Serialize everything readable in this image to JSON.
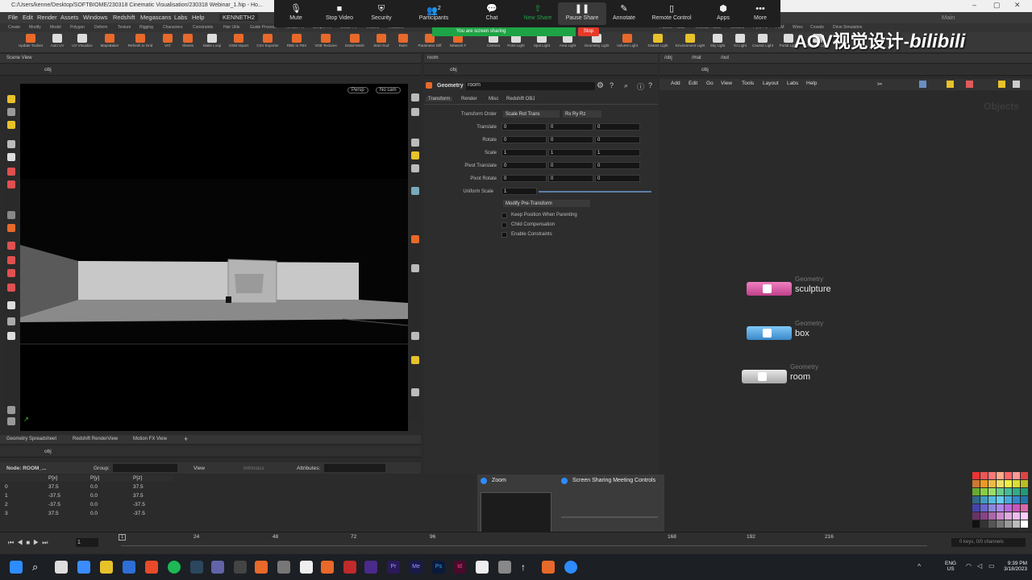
{
  "titlebar": {
    "path": "C:/Users/kenne/Desktop/SOFTBIOME/230318 Cinematic Visualisation/230318 Webinar_1.hip - Ho..."
  },
  "menubar": {
    "items": [
      "File",
      "Edit",
      "Render",
      "Assets",
      "Windows",
      "Redshift",
      "Megascans",
      "Labs",
      "Help"
    ],
    "desktop": "KENNETH2",
    "main": "Main"
  },
  "shelf_tabs": [
    "Create",
    "Modify",
    "Model",
    "Polygon",
    "Deform",
    "Texture",
    "Rigging",
    "Characters",
    "Constraints",
    "Hair Utils",
    "Guide Process",
    "Terrain FX",
    "Simple FX",
    "Cloud FX",
    "Volume",
    "Redshift",
    "Particle Fluids",
    "Viscous Fluids",
    "Oceans",
    "Pyro FX",
    "FEM",
    "Wires",
    "Crowds",
    "Drive Simulation"
  ],
  "shelf_tools": [
    "Update Toolset",
    "Auto UV",
    "UV Visualize",
    "MapsBaker",
    "Refresh to Grid",
    "VAT",
    "Sheets",
    "Make Loop",
    "OSM Import",
    "CSV Exporter",
    "RBD to FBX",
    "VDB Textures",
    "Detail Mesh",
    "Start GoZ",
    "Ruler",
    "Parameter Diff",
    "Network F",
    "Camera",
    "Point Light",
    "Spot Light",
    "Area Light",
    "Geometry Light",
    "Volume Light",
    "Distant Light",
    "Environment Light",
    "Sky Light",
    "GI Light",
    "Caustic Light",
    "Portal Light",
    "Ambient Light"
  ],
  "zoom": {
    "buttons": [
      {
        "label": "Mute",
        "icon": "microphone-icon"
      },
      {
        "label": "Stop Video",
        "icon": "video-camera-icon"
      },
      {
        "label": "Security",
        "icon": "shield-icon"
      },
      {
        "label": "Participants",
        "icon": "participants-icon",
        "count": "2"
      },
      {
        "label": "Chat",
        "icon": "chat-icon"
      },
      {
        "label": "New Share",
        "icon": "share-icon"
      },
      {
        "label": "Pause Share",
        "icon": "pause-icon"
      },
      {
        "label": "Annotate",
        "icon": "pencil-icon"
      },
      {
        "label": "Remote Control",
        "icon": "mouse-icon"
      },
      {
        "label": "Apps",
        "icon": "apps-icon"
      },
      {
        "label": "More",
        "icon": "more-icon"
      }
    ],
    "sharing_banner": "You are screen sharing",
    "stop_label": "Stop",
    "popup_tabs": [
      "Zoom",
      "Screen Sharing Meeting Controls"
    ]
  },
  "watermark": "AOV视觉设计-",
  "watermark_brand": "bilibili",
  "scene_view": {
    "tab": "Scene View",
    "path": "obj",
    "persp": "Persp",
    "cam": "No cam"
  },
  "params": {
    "tab": "room",
    "path": "obj",
    "node_type": "Geometry",
    "node_name": "room",
    "tabs": [
      "Transform",
      "Render",
      "Misc",
      "Redshift OBJ"
    ],
    "transform_order": "Scale Rot Trans",
    "rotate_order": "Rx Ry Rz",
    "rows": [
      {
        "label": "Transform Order"
      },
      {
        "label": "Translate",
        "values": [
          "0",
          "0",
          "0"
        ]
      },
      {
        "label": "Rotate",
        "values": [
          "0",
          "0",
          "0"
        ]
      },
      {
        "label": "Scale",
        "values": [
          "1",
          "1",
          "1"
        ]
      },
      {
        "label": "Pivot Translate",
        "values": [
          "0",
          "0",
          "0"
        ]
      },
      {
        "label": "Pivot Rotate",
        "values": [
          "0",
          "0",
          "0"
        ]
      },
      {
        "label": "Uniform Scale",
        "values": [
          "1"
        ]
      }
    ],
    "modify_pre": "Modify Pre-Transform",
    "checks": [
      "Keep Position When Parenting",
      "Child Compensation",
      "Enable Constraints"
    ]
  },
  "network": {
    "tabs": [
      "/obj",
      "/mat",
      "/out"
    ],
    "path": "obj",
    "menu": [
      "Add",
      "Edit",
      "Go",
      "View",
      "Tools",
      "Layout",
      "Labs",
      "Help"
    ],
    "context": "Objects",
    "nodes": [
      {
        "type": "Geometry",
        "name": "sculpture",
        "color": "#e05aa8"
      },
      {
        "type": "Geometry",
        "name": "box",
        "color": "#55a8e0"
      },
      {
        "type": "Geometry",
        "name": "room",
        "color": "#cccccc"
      }
    ]
  },
  "spreadsheet": {
    "tabs": [
      "Geometry Spreadsheet",
      "Redshift RenderView",
      "Motion FX View"
    ],
    "path": "obj",
    "node": "Node: ROOM_...",
    "group_label": "Group:",
    "view_label": "View",
    "intrinsics": "Intrinsics",
    "attributes_label": "Attributes:",
    "columns": [
      "",
      "P[x]",
      "P[y]",
      "P[z]"
    ],
    "rows": [
      [
        "0",
        "37.5",
        "0.0",
        "37.5"
      ],
      [
        "1",
        "-37.5",
        "0.0",
        "37.5"
      ],
      [
        "2",
        "-37.5",
        "0.0",
        "-37.5"
      ],
      [
        "3",
        "37.5",
        "0.0",
        "-37.5"
      ]
    ]
  },
  "timeline": {
    "frame": "1",
    "start_marker": "1",
    "ticks": [
      "24",
      "48",
      "72",
      "96",
      "168",
      "192",
      "216"
    ],
    "keys": "0 keys, 0/0 channels"
  },
  "taskbar": {
    "lang": "ENG",
    "region": "US",
    "time": "9:39 PM",
    "date": "3/18/2023"
  },
  "colors": {
    "zoom_green": "#1ea446",
    "stop_red": "#e53a2a",
    "accent_orange": "#e8692a"
  }
}
